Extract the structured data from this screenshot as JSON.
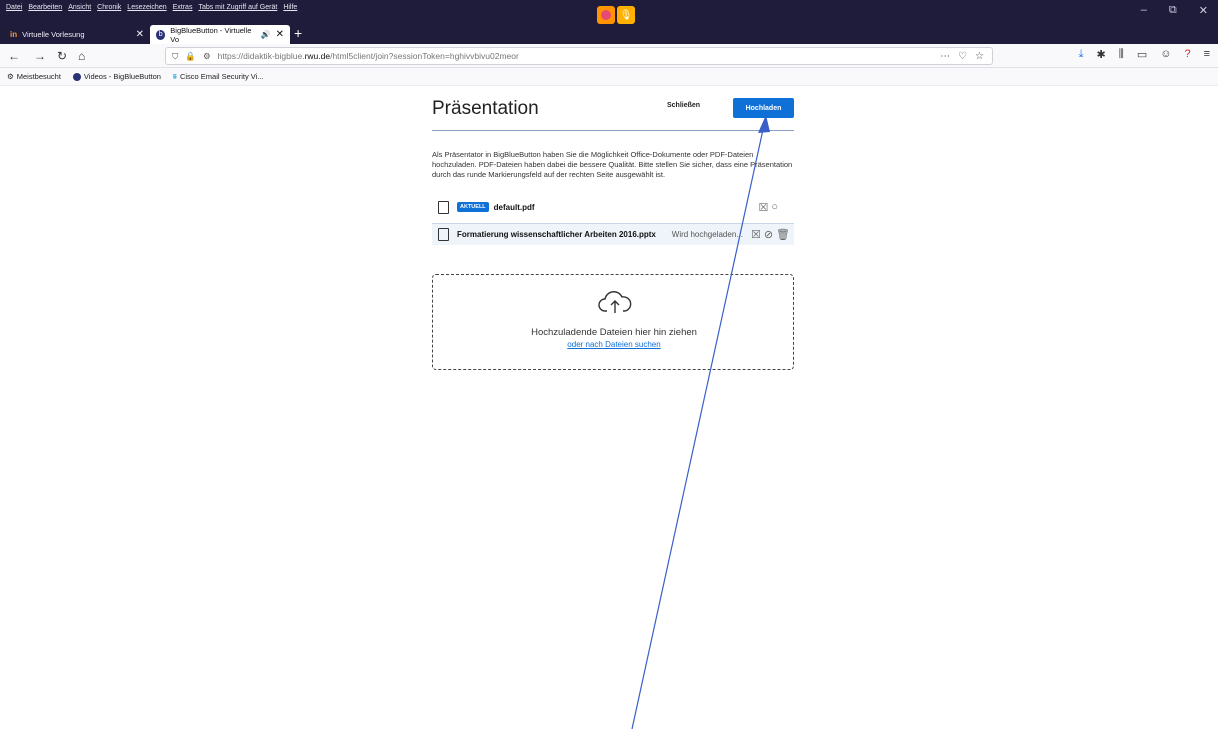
{
  "menu": [
    "Datei",
    "Bearbeiten",
    "Ansicht",
    "Chronik",
    "Lesezeichen",
    "Extras",
    "Tabs mit Zugriff auf Gerät",
    "Hilfe"
  ],
  "tabs": [
    {
      "icon": "in",
      "label": "Virtuelle Vorlesung"
    },
    {
      "label": "BigBlueButton - Virtuelle Vo"
    }
  ],
  "window_controls": {
    "minimize": "–",
    "restore": "⧉",
    "close": "✕"
  },
  "nav": {
    "url_prefix": "https://didaktik-bigblue.",
    "url_domain": "rwu.de",
    "url_path": "/html5client/join?sessionToken=hghivvbivu02meor"
  },
  "bookmarks": [
    "Meistbesucht",
    "Videos - BigBlueButton",
    "Cisco Email Security Vi..."
  ],
  "modal": {
    "title": "Präsentation",
    "close_label": "Schließen",
    "upload_label": "Hochladen",
    "description": "Als Präsentator in BigBlueButton haben Sie die Möglichkeit Office-Dokumente oder PDF-Dateien hochzuladen. PDF-Dateien haben dabei die bessere Qualität. Bitte stellen Sie sicher, dass eine Präsentation durch das runde Markierungsfeld auf der rechten Seite ausgewählt ist.",
    "files": [
      {
        "badge": "AKTUELL",
        "name": "default.pdf",
        "status": ""
      },
      {
        "badge": "",
        "name": "Formatierung wissenschaftlicher Arbeiten 2016.pptx",
        "status": "Wird hochgeladen..."
      }
    ],
    "dropzone_text": "Hochzuladende Dateien hier hin ziehen",
    "dropzone_link": "oder nach Dateien suchen"
  },
  "colors": {
    "accent": "#0f70d7",
    "annotation_arrow": "#3a5fc8",
    "titlebar": "#1f1b3a"
  }
}
